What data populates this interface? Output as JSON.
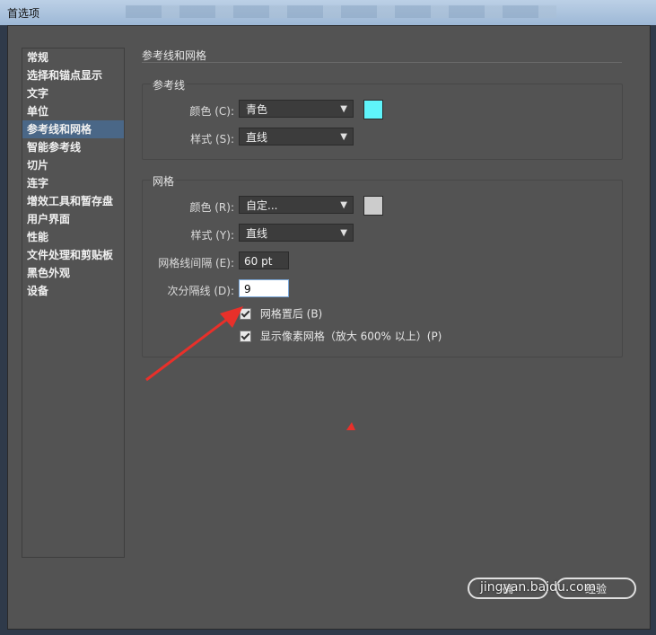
{
  "window": {
    "title": "首选项"
  },
  "sidebar": {
    "items": [
      {
        "label": "常规"
      },
      {
        "label": "选择和锚点显示"
      },
      {
        "label": "文字"
      },
      {
        "label": "单位"
      },
      {
        "label": "参考线和网格",
        "selected": true
      },
      {
        "label": "智能参考线"
      },
      {
        "label": "切片"
      },
      {
        "label": "连字"
      },
      {
        "label": "增效工具和暂存盘"
      },
      {
        "label": "用户界面"
      },
      {
        "label": "性能"
      },
      {
        "label": "文件处理和剪贴板"
      },
      {
        "label": "黑色外观"
      },
      {
        "label": "设备"
      }
    ]
  },
  "main": {
    "section_title": "参考线和网格",
    "guides": {
      "title": "参考线",
      "color_label": "颜色 (C):",
      "color_value": "青色",
      "color_swatch": "#5ff4fa",
      "style_label": "样式 (S):",
      "style_value": "直线"
    },
    "grid": {
      "title": "网格",
      "color_label": "颜色 (R):",
      "color_value": "自定...",
      "color_swatch": "#cccccc",
      "style_label": "样式 (Y):",
      "style_value": "直线",
      "gridline_every_label": "网格线间隔 (E):",
      "gridline_every_value": "60 pt",
      "subdivisions_label": "次分隔线 (D):",
      "subdivisions_value": "9",
      "grids_in_back_label": "网格置后 (B)",
      "grids_in_back_checked": true,
      "show_pixel_grid_label": "显示像素网格（放大 600% 以上）(P)",
      "show_pixel_grid_checked": true
    }
  },
  "footer": {
    "ok_label": "确",
    "cancel_label": "经验",
    "watermark": "jingyan.baidu.com"
  },
  "colors": {
    "panel_bg": "#535353",
    "selected_bg": "#4a6787",
    "annotation_arrow": "#e8302a"
  }
}
